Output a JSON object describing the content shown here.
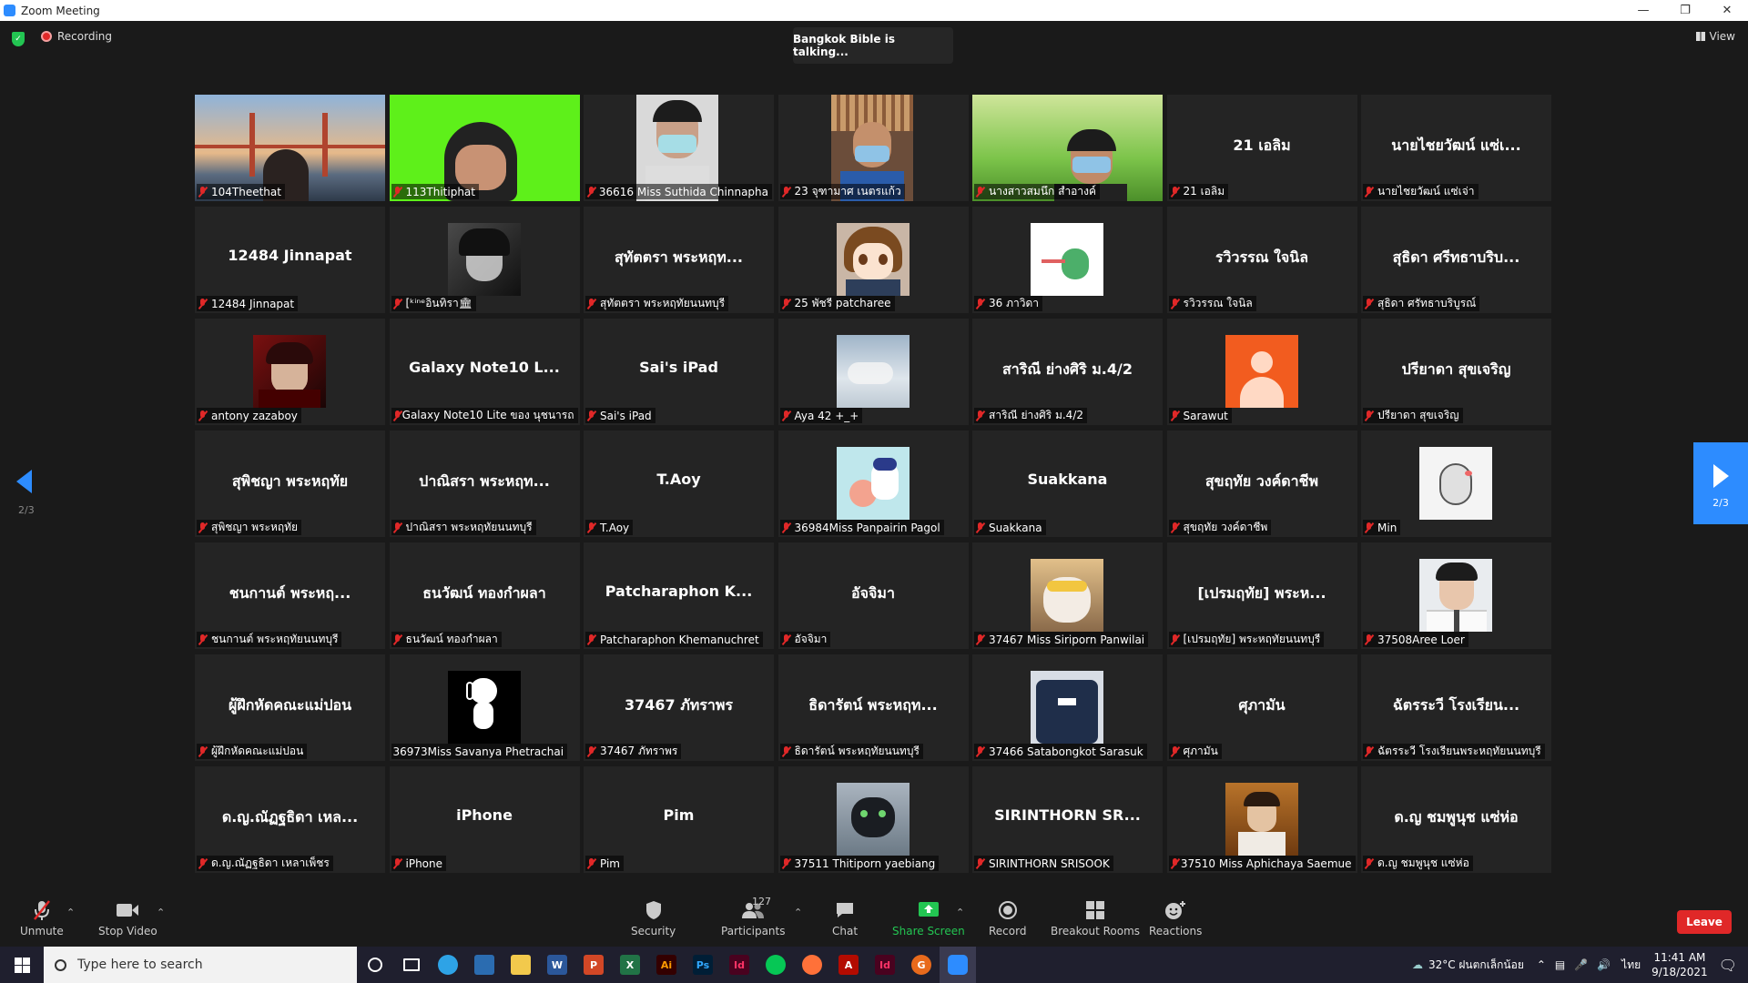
{
  "window": {
    "title": "Zoom Meeting"
  },
  "topbar": {
    "recording": "Recording",
    "talking": "Bangkok Bible is talking...",
    "view": "View"
  },
  "pagination": {
    "left": "2/3",
    "right": "2/3"
  },
  "tiles": [
    {
      "big": "",
      "label": "104Theethat",
      "kind": "photo-bridge"
    },
    {
      "big": "",
      "label": "113Thitiphat",
      "kind": "photo-green"
    },
    {
      "big": "",
      "label": "36616 Miss Suthida Chinnapha",
      "kind": "photo-face"
    },
    {
      "big": "",
      "label": "23 จุฑามาศ เนตรแก้ว",
      "kind": "photo-face2"
    },
    {
      "big": "",
      "label": "นางสาวสมนึก สำอางค์",
      "kind": "photo-grass"
    },
    {
      "big": "21 เอลิม",
      "label": "21 เอลิม",
      "kind": "name"
    },
    {
      "big": "นายไชยวัฒน์ แซ่เ...",
      "label": "นายไชยวัฒน์ แซ่เจ่า",
      "kind": "name"
    },
    {
      "big": "12484 Jinnapat",
      "label": "12484 Jinnapat",
      "kind": "name"
    },
    {
      "big": "",
      "label": "[ᵏⁱⁿᵉอินทิรา🏛",
      "kind": "avatar-dark"
    },
    {
      "big": "สุทัตตรา พระหฤท...",
      "label": "สุทัตตรา พระหฤทัยนนทบุรี",
      "kind": "name"
    },
    {
      "big": "",
      "label": "25 พัชรี patcharee",
      "kind": "avatar-anime"
    },
    {
      "big": "",
      "label": "36 ภาวิดา",
      "kind": "avatar-dino"
    },
    {
      "big": "รวิวรรณ ใจนิล",
      "label": "รวิวรรณ ใจนิล",
      "kind": "name"
    },
    {
      "big": "สุธิดา ศรีทธาบริบ...",
      "label": "สุธิดา ศรัทธาบริบูรณ์",
      "kind": "name"
    },
    {
      "big": "",
      "label": "antony zazaboy",
      "kind": "avatar-red"
    },
    {
      "big": "Galaxy Note10 L...",
      "label": "Galaxy Note10 Lite ของ นุชนารถ",
      "kind": "name"
    },
    {
      "big": "Sai's iPad",
      "label": "Sai's iPad",
      "kind": "name"
    },
    {
      "big": "",
      "label": "Aya 42 +_+",
      "kind": "avatar-sky"
    },
    {
      "big": "สาริณี ย่างศิริ ม.4/2",
      "label": "สาริณี ย่างศิริ ม.4/2",
      "kind": "name"
    },
    {
      "big": "",
      "label": "Sarawut",
      "kind": "avatar-default"
    },
    {
      "big": "ปรียาดา สุขเจริญ",
      "label": "ปรียาดา สุขเจริญ",
      "kind": "name"
    },
    {
      "big": "สุพิชญา พระหฤทัย",
      "label": "สุพิชญา พระหฤทัย",
      "kind": "name"
    },
    {
      "big": "ปาณิสรา พระหฤท...",
      "label": "ปาณิสรา พระหฤทัยนนทบุรี",
      "kind": "name"
    },
    {
      "big": "T.Aoy",
      "label": "T.Aoy",
      "kind": "name"
    },
    {
      "big": "",
      "label": "36984Miss Panpairin Pagol",
      "kind": "avatar-cartoon"
    },
    {
      "big": "Suakkana",
      "label": "Suakkana",
      "kind": "name"
    },
    {
      "big": "สุขฤทัย วงค์ดาชีพ",
      "label": "สุขฤทัย วงค์ดาชีพ",
      "kind": "name"
    },
    {
      "big": "",
      "label": "Min",
      "kind": "avatar-sketch"
    },
    {
      "big": "ชนกานต์ พระหฤ...",
      "label": "ชนกานต์ พระหฤทัยนนทบุรี",
      "kind": "name"
    },
    {
      "big": "ธนวัฒน์ ทองกำผลา",
      "label": "ธนวัฒน์ ทองกำผลา",
      "kind": "name"
    },
    {
      "big": "Patcharaphon K...",
      "label": "Patcharaphon Khemanuchret",
      "kind": "name"
    },
    {
      "big": "อัจจิมา",
      "label": "อัจจิมา",
      "kind": "name"
    },
    {
      "big": "",
      "label": "37467 Miss Siriporn Panwilai",
      "kind": "avatar-cat"
    },
    {
      "big": "[เปรมฤทัย] พระห...",
      "label": "[เปรมฤทัย] พระหฤทัยนนทบุรี",
      "kind": "name"
    },
    {
      "big": "",
      "label": "37508Aree Loer",
      "kind": "avatar-boy"
    },
    {
      "big": "ผู้ฝึกหัดคณะแม่ปอน",
      "label": "ผู้ฝึกหัดคณะแม่ปอน",
      "kind": "name"
    },
    {
      "big": "",
      "label": "36973Miss Savanya Phetrachai",
      "kind": "avatar-snoopy",
      "nomic": true
    },
    {
      "big": "37467 ภัทราพร",
      "label": "37467 ภัทราพร",
      "kind": "name"
    },
    {
      "big": "ธิดารัตน์ พระหฤท...",
      "label": "ธิดารัตน์ พระหฤทัยนนทบุรี",
      "kind": "name"
    },
    {
      "big": "",
      "label": "37466 Satabongkot Sarasuk",
      "kind": "avatar-shirt"
    },
    {
      "big": "ศุภามัน",
      "label": "ศุภามัน",
      "kind": "name"
    },
    {
      "big": "ฉัตรระวี โรงเรียน...",
      "label": "ฉัตรระวี โรงเรียนพระหฤทัยนนทบุรี",
      "kind": "name"
    },
    {
      "big": "ด.ญ.ณัฏฐธิดา เหล...",
      "label": "ด.ญ.ณัฏฐธิดา เหลาเพ็ชร",
      "kind": "name"
    },
    {
      "big": "iPhone",
      "label": "iPhone",
      "kind": "name"
    },
    {
      "big": "Pim",
      "label": "Pim",
      "kind": "name"
    },
    {
      "big": "",
      "label": "37511 Thitiporn yaebiang",
      "kind": "avatar-dragon"
    },
    {
      "big": "SIRINTHORN SR...",
      "label": "SIRINTHORN SRISOOK",
      "kind": "name"
    },
    {
      "big": "",
      "label": "37510 Miss Aphichaya Saemue",
      "kind": "avatar-autumn"
    },
    {
      "big": "ด.ญ ชมพูนุช แซ่ห่อ",
      "label": "ด.ญ ชมพูนุช แซ่ห่อ",
      "kind": "name"
    }
  ],
  "toolbar": {
    "unmute": "Unmute",
    "stop_video": "Stop Video",
    "security": "Security",
    "participants": "Participants",
    "participant_count": "127",
    "chat": "Chat",
    "share_screen": "Share Screen",
    "record": "Record",
    "breakout": "Breakout Rooms",
    "reactions": "Reactions",
    "leave": "Leave"
  },
  "taskbar": {
    "search_placeholder": "Type here to search",
    "weather": "32°C  ฝนตกเล็กน้อย",
    "lang": "ไทย",
    "time": "11:41 AM",
    "date": "9/18/2021"
  },
  "colors": {
    "accent": "#2d8cff",
    "leave": "#e02828",
    "share": "#23c552"
  }
}
